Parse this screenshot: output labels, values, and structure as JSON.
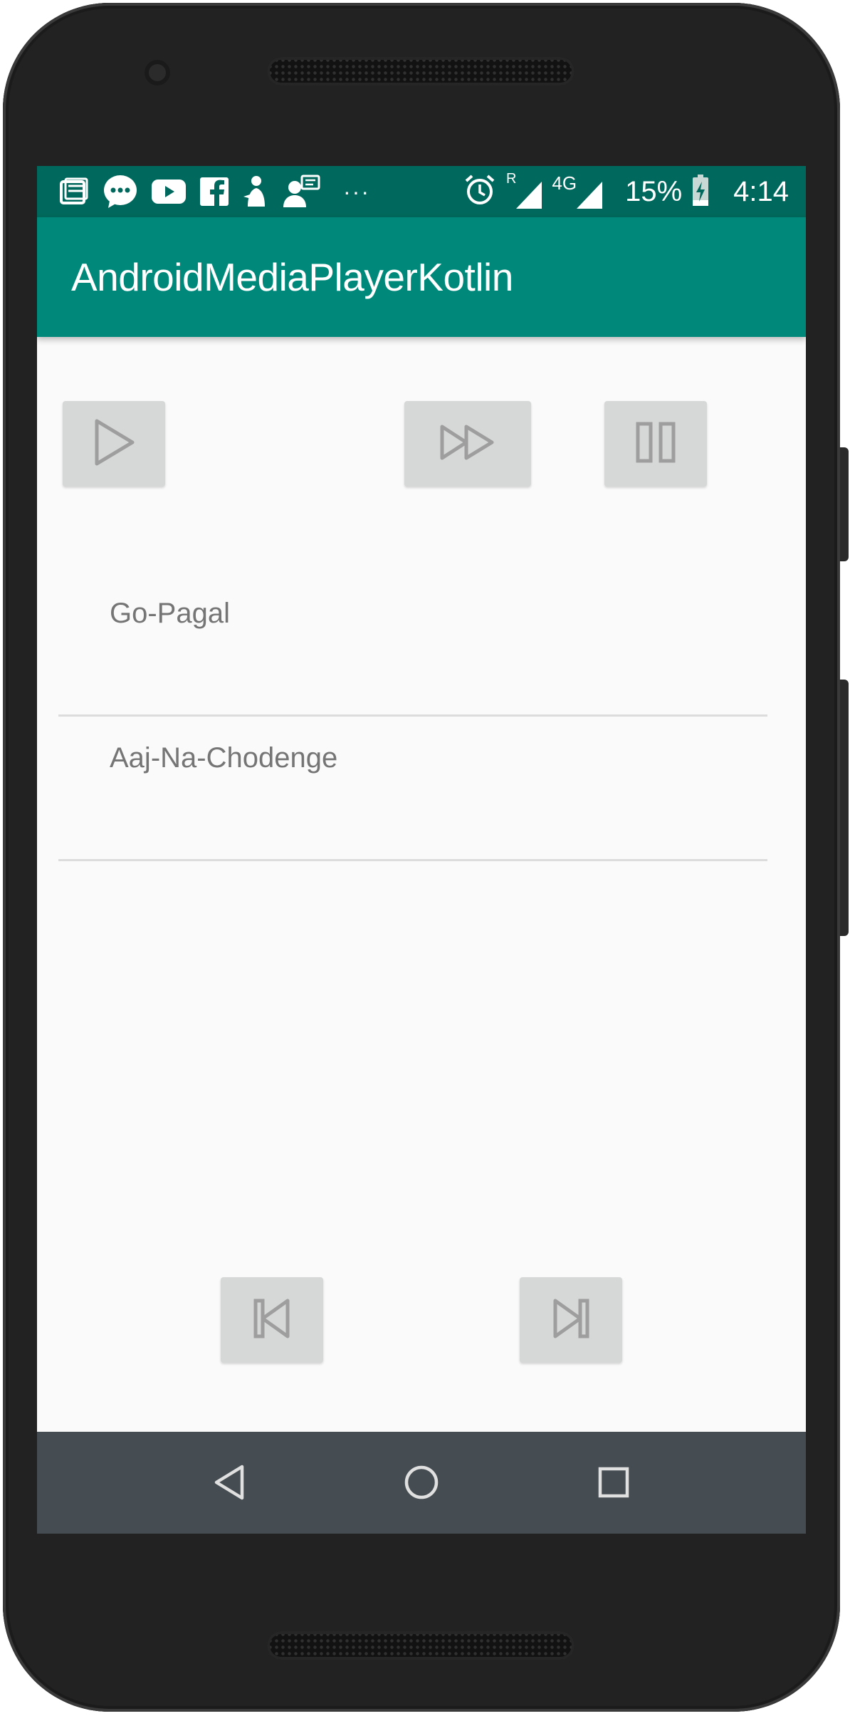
{
  "status_bar": {
    "battery_percent": "15%",
    "time": "4:14",
    "network_type": "4G",
    "roaming_label": "R",
    "overflow_dots": "···",
    "left_icons": [
      "news-icon",
      "messenger-icon",
      "youtube-icon",
      "facebook-icon",
      "android-notification-icon",
      "contact-message-icon"
    ],
    "right_icons": [
      "alarm-icon",
      "roaming-signal-icon",
      "cell-signal-icon",
      "battery-charging-icon"
    ]
  },
  "app_bar": {
    "title": "AndroidMediaPlayerKotlin"
  },
  "controls": {
    "top": [
      "play-button",
      "fast-forward-button",
      "pause-button"
    ],
    "bottom": [
      "previous-button",
      "next-button"
    ]
  },
  "songs": [
    {
      "title": "Go-Pagal"
    },
    {
      "title": "Aaj-Na-Chodenge"
    }
  ],
  "nav_bar": {
    "buttons": [
      "back-icon",
      "home-icon",
      "recents-icon"
    ]
  },
  "colors": {
    "status_bar": "#00685c",
    "app_bar": "#00897b",
    "button_bg": "#d6d7d7",
    "icon_stroke": "#9e9e9e",
    "nav_bar": "#454d52",
    "screen_bg": "#fafafa"
  }
}
